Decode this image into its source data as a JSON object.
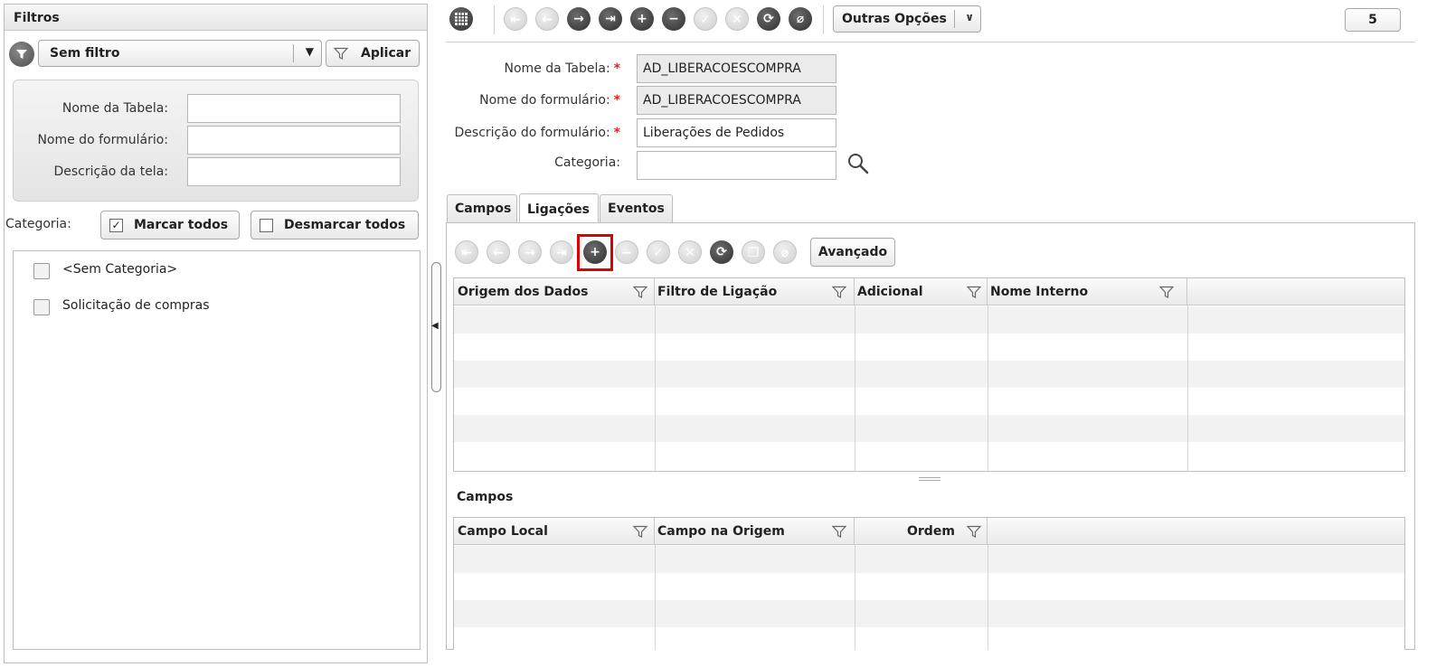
{
  "left_panel": {
    "title": "Filtros",
    "filter_select": "Sem filtro",
    "apply_button": "Aplicar",
    "fields": [
      {
        "label": "Nome da Tabela:",
        "value": ""
      },
      {
        "label": "Nome do formulário:",
        "value": ""
      },
      {
        "label": "Descrição da tela:",
        "value": ""
      }
    ],
    "category_label": "Categoria:",
    "mark_all": "Marcar todos",
    "unmark_all": "Desmarcar todos",
    "categories": [
      "<Sem Categoria>",
      "Solicitação de compras"
    ]
  },
  "toolbar": {
    "other_options": "Outras Opções",
    "record_count": "5",
    "icons": [
      "grid-icon",
      "first-record-icon",
      "previous-record-icon",
      "next-record-icon",
      "last-record-icon",
      "add-icon",
      "remove-icon",
      "confirm-icon",
      "cancel-icon",
      "refresh-icon",
      "attach-icon"
    ]
  },
  "form": {
    "table_name_label": "Nome da Tabela:",
    "table_name_value": "AD_LIBERACOESCOMPRA",
    "form_name_label": "Nome do formulário:",
    "form_name_value": "AD_LIBERACOESCOMPRA",
    "form_desc_label": "Descrição do formulário:",
    "form_desc_value": "Liberações de Pedidos",
    "category_label": "Categoria:",
    "category_value": "",
    "required_mark": "*"
  },
  "tabs": [
    {
      "label": "Campos",
      "active": false
    },
    {
      "label": "Ligações",
      "active": true
    },
    {
      "label": "Eventos",
      "active": false
    }
  ],
  "links_toolbar": {
    "advanced_button": "Avançado",
    "highlighted": "add-button",
    "highlight_color": "#e00000"
  },
  "links_grid": {
    "columns": [
      "Origem dos Dados",
      "Filtro de Ligação",
      "Adicional",
      "Nome Interno"
    ],
    "rows": []
  },
  "fields_section": {
    "title": "Campos",
    "columns": [
      "Campo Local",
      "Campo na Origem",
      "Ordem"
    ],
    "rows": []
  }
}
